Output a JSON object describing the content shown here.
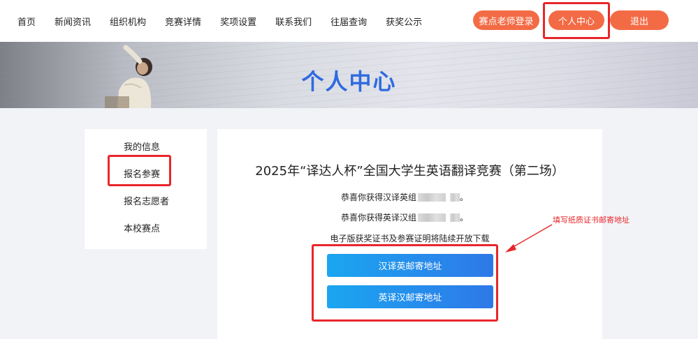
{
  "nav": {
    "items": [
      "首页",
      "新闻资讯",
      "组织机构",
      "竞赛详情",
      "奖项设置",
      "联系我们",
      "往届查询",
      "获奖公示"
    ],
    "coach_login": "赛点老师登录",
    "personal_center": "个人中心",
    "logout": "退出"
  },
  "banner": {
    "title": "个人中心"
  },
  "sidebar": {
    "items": [
      {
        "label": "我的信息"
      },
      {
        "label": "报名参赛"
      },
      {
        "label": "报名志愿者"
      },
      {
        "label": "本校赛点"
      }
    ]
  },
  "main": {
    "contest_title": "2025年“译达人杯”全国大学生英语翻译竞赛（第二场）",
    "award_line_1": "恭喜你获得汉译英组",
    "award_line_2": "恭喜你获得英译汉组",
    "award_suffix": "。",
    "notice": "电子版获奖证书及参赛证明将陆续开放下载",
    "btn_c2e_mail": "汉译英邮寄地址",
    "btn_e2c_mail": "英译汉邮寄地址"
  },
  "annotation": {
    "text": "填写纸质证书邮寄地址"
  },
  "colors": {
    "accent_orange": "#f36b45",
    "title_blue": "#2f6be0",
    "highlight_red": "#e8262a",
    "button_blue": "#1aa6f0"
  }
}
